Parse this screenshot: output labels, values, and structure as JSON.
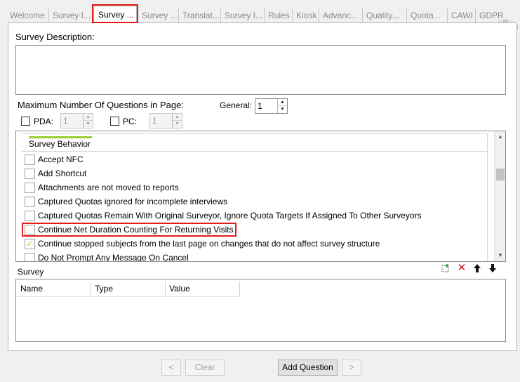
{
  "tabs": [
    {
      "label": "Welcome",
      "active": false
    },
    {
      "label": "Survey I...",
      "active": false
    },
    {
      "label": "Survey ...",
      "active": true
    },
    {
      "label": "Survey ...",
      "active": false
    },
    {
      "label": "Translat...",
      "active": false
    },
    {
      "label": "Survey I...",
      "active": false
    },
    {
      "label": "Rules",
      "active": false
    },
    {
      "label": "Kiosk",
      "active": false
    },
    {
      "label": "Advanc...",
      "active": false
    },
    {
      "label": "Quality...",
      "active": false
    },
    {
      "label": "Quota...",
      "active": false
    },
    {
      "label": "CAWI",
      "active": false
    },
    {
      "label": "GDPR",
      "active": false
    }
  ],
  "form": {
    "description_label": "Survey Description:",
    "description_value": "",
    "max_questions_label": "Maximum Number Of Questions in Page:",
    "general_label": "General:",
    "general_value": "1",
    "pda_label": "PDA:",
    "pda_value": "1",
    "pc_label": "PC:",
    "pc_value": "1"
  },
  "properties": {
    "group_label": "Survey Behavior",
    "items": [
      {
        "label": "Accept NFC",
        "checked": false
      },
      {
        "label": "Add Shortcut",
        "checked": false
      },
      {
        "label": "Attachments are not moved to reports",
        "checked": false
      },
      {
        "label": "Captured Quotas ignored for incomplete interviews",
        "checked": false
      },
      {
        "label": "Captured Quotas Remain With Original Surveyor, Ignore Quota Targets If Assigned To Other Surveyors",
        "checked": false
      },
      {
        "label": "Continue Net Duration Counting For Returning Visits",
        "checked": false
      },
      {
        "label": "Continue stopped subjects from the last page on changes that do not affect survey structure",
        "checked": true
      },
      {
        "label": "Do Not Prompt Any Message On Cancel",
        "checked": false
      }
    ]
  },
  "survey_section": {
    "label": "Survey",
    "columns": [
      "Name",
      "Type",
      "Value"
    ],
    "toolbar_icons": [
      "add-row-icon",
      "delete-icon",
      "move-up-icon",
      "move-down-icon"
    ]
  },
  "buttons": {
    "prev_label": "<",
    "clear_label": "Clear",
    "add_question_label": "Add Question",
    "next_label": ">"
  },
  "colors": {
    "highlight": "#e41c1c",
    "accent_green": "#9acd32"
  }
}
